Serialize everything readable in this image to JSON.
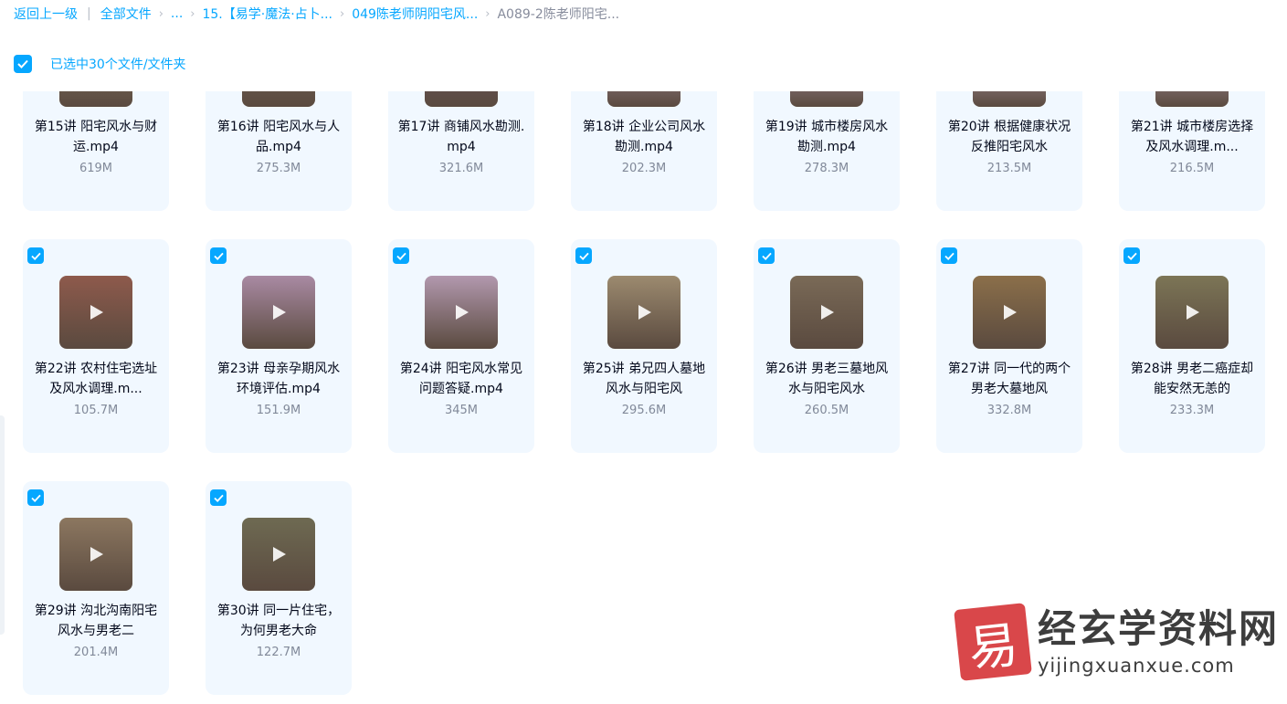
{
  "breadcrumb": {
    "back": "返回上一级",
    "sep": "|",
    "all_files": "全部文件",
    "ellipsis": "...",
    "folder1": "15.【易学·魔法·占卜...",
    "folder2": "049陈老师阴阳宅风...",
    "current": "A089-2陈老师阳宅..."
  },
  "selection": {
    "text": "已选中30个文件/文件夹",
    "checked": true
  },
  "files": [
    {
      "name": "第15讲 阳宅风水与财运.mp4",
      "size": "619M",
      "thumb": "#8a7a6a",
      "checked": false
    },
    {
      "name": "第16讲 阳宅风水与人品.mp4",
      "size": "275.3M",
      "thumb": "#7c6d63",
      "checked": false
    },
    {
      "name": "第17讲 商铺风水勘测.mp4",
      "size": "321.6M",
      "thumb": "#6f5a6a",
      "checked": false
    },
    {
      "name": "第18讲 企业公司风水勘测.mp4",
      "size": "202.3M",
      "thumb": "#b79bb5",
      "checked": false
    },
    {
      "name": "第19讲 城市楼房风水勘测.mp4",
      "size": "278.3M",
      "thumb": "#c3a9c4",
      "checked": false
    },
    {
      "name": "第20讲 根据健康状况反推阳宅风水",
      "size": "213.5M",
      "thumb": "#cbb3cc",
      "checked": false
    },
    {
      "name": "第21讲 城市楼房选择及风水调理.m...",
      "size": "216.5M",
      "thumb": "#c7b0c6",
      "checked": false
    },
    {
      "name": "第22讲 农村住宅选址及风水调理.m...",
      "size": "105.7M",
      "thumb": "#8e5a4c",
      "checked": true
    },
    {
      "name": "第23讲 母亲孕期风水环境评估.mp4",
      "size": "151.9M",
      "thumb": "#a98aa3",
      "checked": true
    },
    {
      "name": "第24讲 阳宅风水常见问题答疑.mp4",
      "size": "345M",
      "thumb": "#b298ae",
      "checked": true
    },
    {
      "name": "第25讲 弟兄四人墓地风水与阳宅风",
      "size": "295.6M",
      "thumb": "#9c8a6f",
      "checked": true
    },
    {
      "name": "第26讲 男老三墓地风水与阳宅风水",
      "size": "260.5M",
      "thumb": "#7a6a57",
      "checked": true
    },
    {
      "name": "第27讲 同一代的两个男老大墓地风",
      "size": "332.8M",
      "thumb": "#8b6f4a",
      "checked": true
    },
    {
      "name": "第28讲 男老二癌症却能安然无恙的",
      "size": "233.3M",
      "thumb": "#7c7556",
      "checked": true
    },
    {
      "name": "第29讲 沟北沟南阳宅风水与男老二",
      "size": "201.4M",
      "thumb": "#8c7760",
      "checked": true
    },
    {
      "name": "第30讲 同一片住宅，为何男老大命",
      "size": "122.7M",
      "thumb": "#6e6a52",
      "checked": true
    }
  ],
  "watermark": {
    "seal": "易",
    "cn": "经玄学资料网",
    "url": "yijingxuanxue.com"
  },
  "colors": {
    "accent": "#06a7ff",
    "card_bg": "#f1f8ff"
  }
}
